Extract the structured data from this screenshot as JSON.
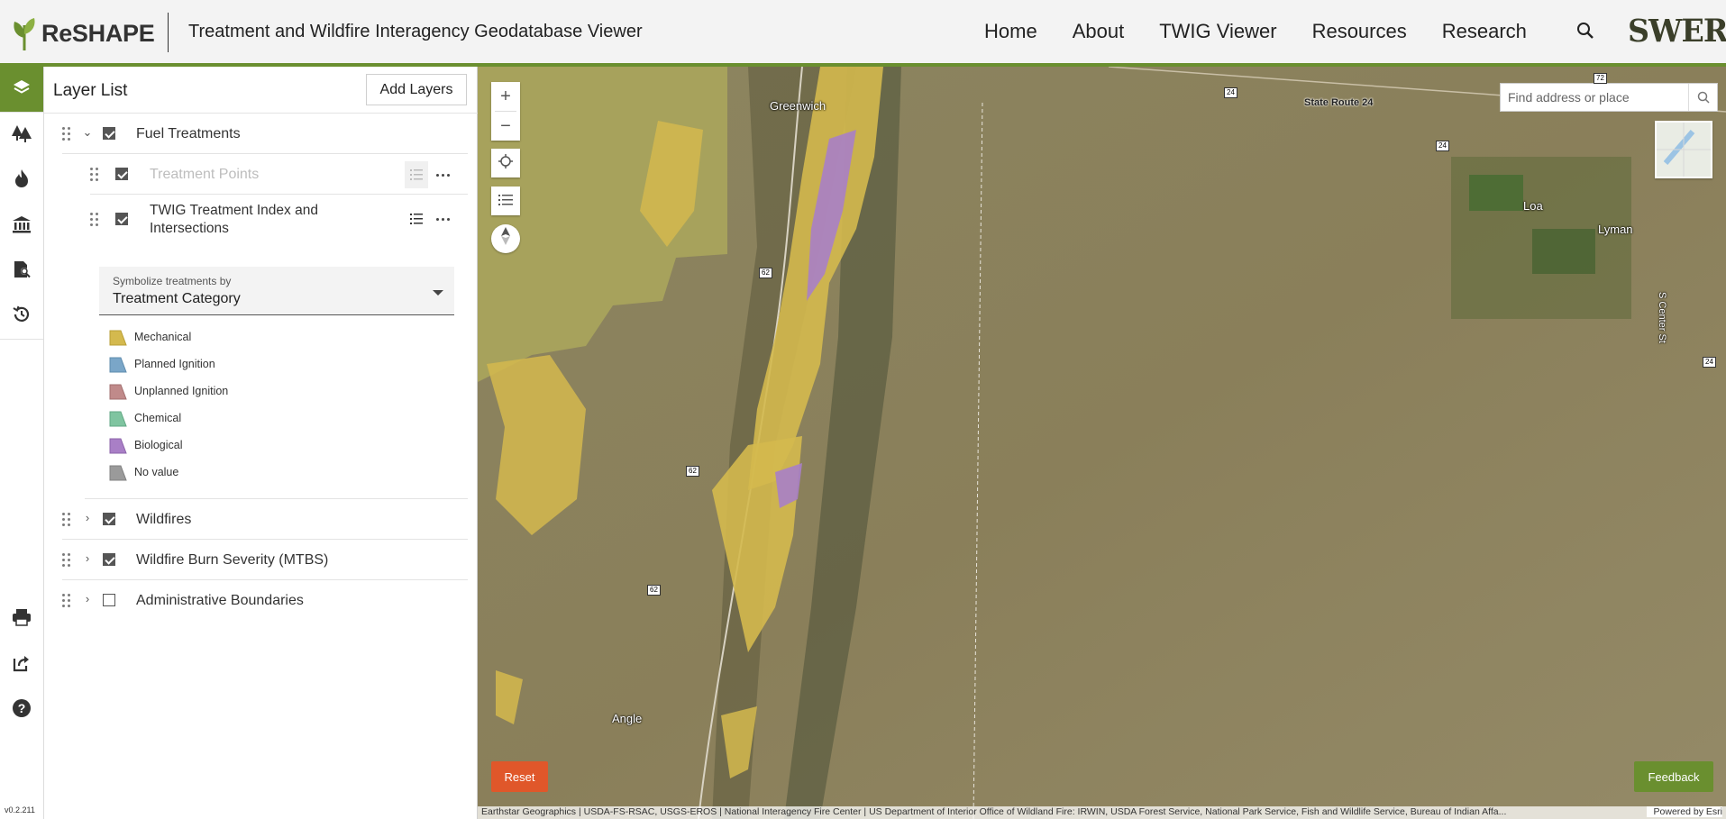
{
  "header": {
    "logo_text": "ReSHAPE",
    "app_title": "Treatment and Wildfire Interagency Geodatabase Viewer",
    "nav": [
      "Home",
      "About",
      "TWIG Viewer",
      "Resources",
      "Research"
    ],
    "search_icon": "search-icon",
    "partner_logo": "SWERI"
  },
  "rail": {
    "top_icons": [
      "layers-icon",
      "trees-icon",
      "fire-icon",
      "institution-icon",
      "document-search-icon",
      "history-icon"
    ],
    "bottom_icons": [
      "print-icon",
      "share-icon",
      "help-icon"
    ],
    "version": "v0.2.211"
  },
  "panel": {
    "title": "Layer List",
    "add_layers_label": "Add Layers",
    "layers": [
      {
        "name": "Fuel Treatments",
        "checked": true,
        "expanded": true
      },
      {
        "name": "Treatment Points",
        "checked": true
      },
      {
        "name": "TWIG Treatment Index and Intersections",
        "checked": true
      },
      {
        "name": "Wildfires",
        "checked": true,
        "expanded": false
      },
      {
        "name": "Wildfire Burn Severity (MTBS)",
        "checked": true,
        "expanded": false
      },
      {
        "name": "Administrative Boundaries",
        "checked": false,
        "expanded": false
      }
    ],
    "symbolize": {
      "label": "Symbolize treatments by",
      "value": "Treatment Category"
    },
    "legend": [
      {
        "label": "Mechanical",
        "color": "#d4b94e"
      },
      {
        "label": "Planned Ignition",
        "color": "#7aa6c8"
      },
      {
        "label": "Unplanned Ignition",
        "color": "#c08a8a"
      },
      {
        "label": "Chemical",
        "color": "#7fc4a0"
      },
      {
        "label": "Biological",
        "color": "#a97fc6"
      },
      {
        "label": "No value",
        "color": "#9a9a9a"
      }
    ]
  },
  "map": {
    "search_placeholder": "Find address or place",
    "reset_label": "Reset",
    "feedback_label": "Feedback",
    "places": [
      "Greenwich",
      "Loa",
      "Lyman",
      "Angle",
      "State Route 24",
      "S Center St"
    ],
    "route_shields": [
      "24",
      "24",
      "72",
      "24",
      "62",
      "62",
      "62"
    ],
    "attribution": "Earthstar Geographics | USDA-FS-RSAC, USGS-EROS | National Interagency Fire Center | US Department of Interior Office of Wildland Fire: IRWIN, USDA Forest Service, National Park Service, Fish and Wildlife Service, Bureau of Indian Affa...",
    "powered_by": "Powered by Esri"
  }
}
